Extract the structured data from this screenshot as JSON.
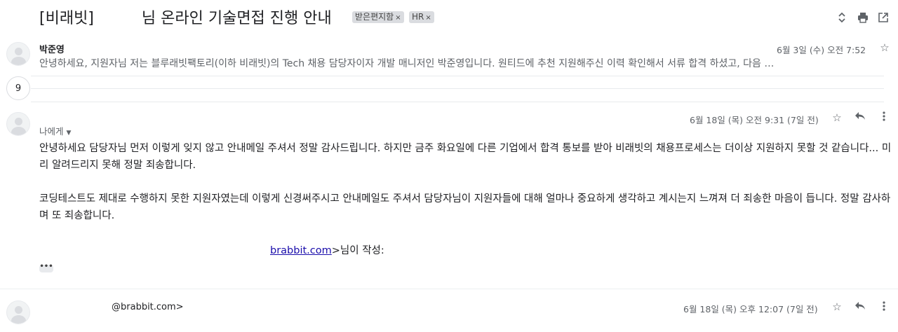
{
  "subject": {
    "prefix": "[비래빗]",
    "text": "님 온라인 기술면접 진행 안내",
    "chips": [
      {
        "label": "받은편지함"
      },
      {
        "label": "HR"
      }
    ],
    "chip_remove_glyph": "×"
  },
  "messages": [
    {
      "sender": "박준영",
      "snippet": "안녕하세요,              지원자님 저는 블루래빗팩토리(이하 비래빗)의 Tech 채용 담당자이자 개발 매니저인 박준영입니다. 원티드에 추천 지원해주신 이력 확인해서 서류 합격 하셨고, 다음 …",
      "date": "6월 3일 (수) 오전 7:52"
    },
    {
      "collapsed_count": "9"
    },
    {
      "to": "나에게",
      "date": "6월 18일 (목) 오전 9:31 (7일 전)",
      "paragraphs": [
        "안녕하세요 담당자님 먼저 이렇게 잊지 않고 안내메일 주셔서 정말 감사드립니다. 하지만 금주 화요일에 다른 기업에서 합격 통보를 받아 비래빗의 채용프로세스는 더이상 지원하지 못할 것 같습니다... 미리 알려드리지 못해 정말 죄송합니다.",
        "코딩테스트도 제대로 수행하지 못한 지원자였는데 이렇게 신경써주시고 안내메일도 주셔서 담당자님이 지원자들에 대해 얼마나 중요하게 생각하고 계시는지 느껴져 더 죄송한 마음이 듭니다. 정말 감사하며 또 죄송합니다."
      ],
      "quote_link": "brabbit.com",
      "quote_suffix": ">님이 작성:",
      "trimmed_glyph": "•••"
    },
    {
      "sender": "@brabbit.com>",
      "date": "6월 18일 (목) 오후 12:07 (7일 전)"
    }
  ],
  "icons": {
    "expand": "expand-collapse-icon",
    "print": "print-icon",
    "popout": "open-in-new-window-icon",
    "star": "star-icon",
    "reply": "reply-icon",
    "more": "more-vert-icon"
  }
}
